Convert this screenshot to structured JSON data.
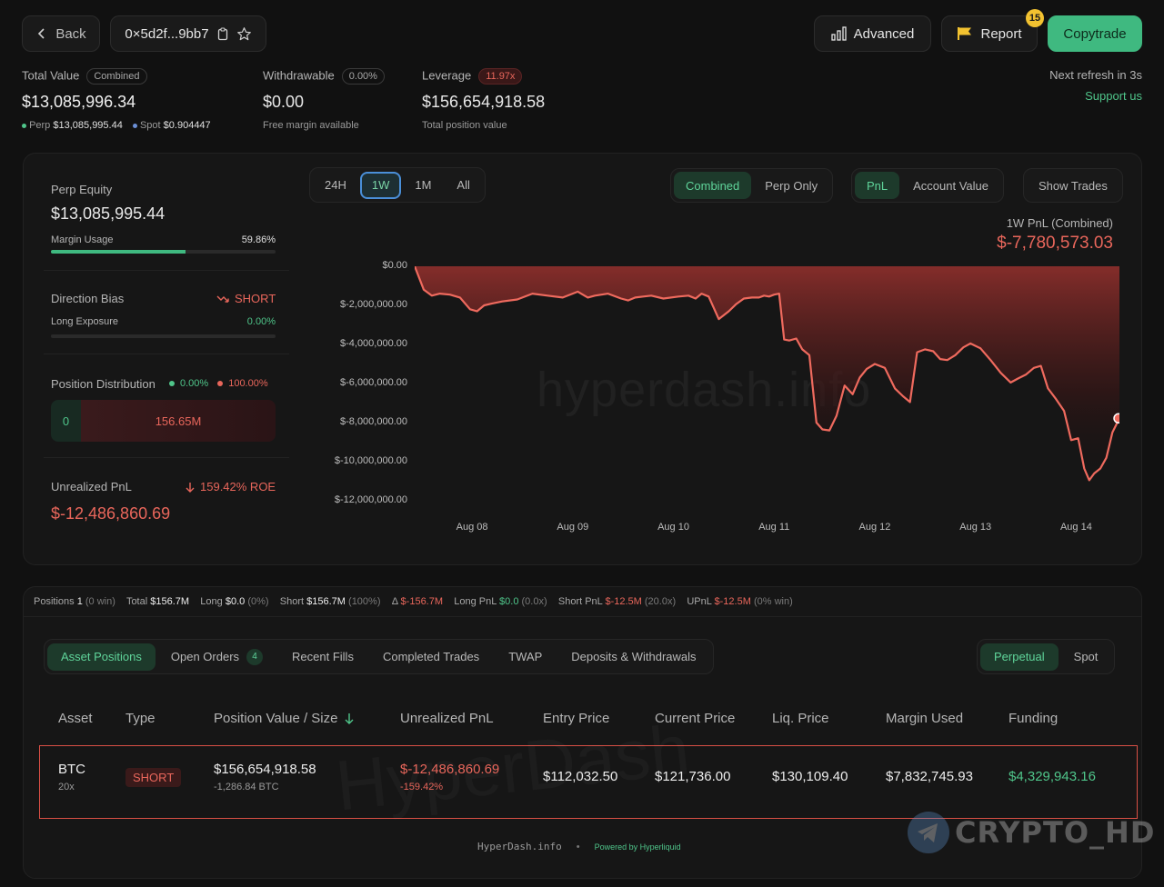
{
  "header": {
    "back_label": "Back",
    "address": "0×5d2f...9bb7",
    "advanced_label": "Advanced",
    "report_label": "Report",
    "report_badge": "15",
    "copytrade_label": "Copytrade"
  },
  "summary": {
    "total_value_label": "Total Value",
    "total_value_pill": "Combined",
    "total_value": "$13,085,996.34",
    "perp_label": "Perp",
    "perp_value": "$13,085,995.44",
    "spot_label": "Spot",
    "spot_value": "$0.904447",
    "withdrawable_label": "Withdrawable",
    "withdrawable_pill": "0.00%",
    "withdrawable_value": "$0.00",
    "withdrawable_sub": "Free margin available",
    "leverage_label": "Leverage",
    "leverage_pill": "11.97x",
    "leverage_value": "$156,654,918.58",
    "leverage_sub": "Total position value",
    "refresh_text": "Next refresh in 3s",
    "support_label": "Support us"
  },
  "left_panel": {
    "perp_equity_label": "Perp Equity",
    "perp_equity": "$13,085,995.44",
    "margin_usage_label": "Margin Usage",
    "margin_usage": "59.86%",
    "margin_usage_fraction": 0.5986,
    "direction_bias_label": "Direction Bias",
    "direction_bias": "SHORT",
    "long_exposure_label": "Long Exposure",
    "long_exposure": "0.00%",
    "position_distribution_label": "Position Distribution",
    "dist_long_pct": "0.00%",
    "dist_short_pct": "100.00%",
    "dist_long_value": "0",
    "dist_short_value": "156.65M",
    "unrealized_pnl_label": "Unrealized PnL",
    "roe": "159.42% ROE",
    "unrealized_pnl": "$-12,486,860.69"
  },
  "chart_controls": {
    "ranges": [
      "24H",
      "1W",
      "1M",
      "All"
    ],
    "active_range": "1W",
    "mode": [
      "Combined",
      "Perp Only"
    ],
    "metric": [
      "PnL",
      "Account Value"
    ],
    "show_trades": "Show Trades"
  },
  "chart_header": {
    "label": "1W PnL (Combined)",
    "value": "$-7,780,573.03"
  },
  "watermark": "hyperdash.info",
  "chart_data": {
    "type": "area",
    "title": "1W PnL (Combined)",
    "xlabel": "",
    "ylabel": "",
    "x_ticks": [
      "Aug 08",
      "Aug 09",
      "Aug 10",
      "Aug 11",
      "Aug 12",
      "Aug 13",
      "Aug 14"
    ],
    "y_ticks": [
      "$0.00",
      "$-2,000,000.00",
      "$-4,000,000.00",
      "$-6,000,000.00",
      "$-8,000,000.00",
      "$-10,000,000.00",
      "$-12,000,000.00"
    ],
    "ylim": [
      -12000000,
      0
    ],
    "xlim": [
      7.43,
      14.43
    ],
    "grid": false,
    "series": [
      {
        "x": [
          7.43,
          7.52,
          7.6,
          7.68,
          7.78,
          7.88,
          7.98,
          8.05,
          8.12,
          8.2,
          8.3,
          8.45,
          8.6,
          8.75,
          8.9,
          9.05,
          9.15,
          9.22,
          9.35,
          9.48,
          9.55,
          9.62,
          9.7,
          9.78,
          9.9,
          10.05,
          10.15,
          10.22,
          10.28,
          10.35,
          10.45,
          10.55,
          10.62,
          10.7,
          10.78,
          10.85,
          10.9,
          10.95,
          11.0,
          11.05,
          11.1,
          11.15,
          11.22,
          11.28,
          11.35,
          11.42,
          11.48,
          11.55,
          11.62,
          11.7,
          11.78,
          11.85,
          11.92,
          12.0,
          12.1,
          12.2,
          12.28,
          12.35,
          12.42,
          12.5,
          12.58,
          12.65,
          12.72,
          12.8,
          12.88,
          12.95,
          13.05,
          13.15,
          13.25,
          13.35,
          13.42,
          13.5,
          13.58,
          13.65,
          13.72,
          13.8,
          13.88,
          13.95,
          14.02,
          14.08,
          14.13,
          14.18,
          14.24,
          14.3,
          14.36,
          14.43
        ],
        "y": [
          0,
          -1200000,
          -1500000,
          -1400000,
          -1450000,
          -1600000,
          -2200000,
          -2300000,
          -2000000,
          -1900000,
          -1800000,
          -1700000,
          -1400000,
          -1500000,
          -1600000,
          -1300000,
          -1600000,
          -1500000,
          -1400000,
          -1650000,
          -1750000,
          -1600000,
          -1550000,
          -1500000,
          -1650000,
          -1550000,
          -1500000,
          -1650000,
          -1400000,
          -1550000,
          -2700000,
          -2300000,
          -1950000,
          -1650000,
          -1600000,
          -1600000,
          -1500000,
          -1550000,
          -1450000,
          -1400000,
          -3750000,
          -3800000,
          -3700000,
          -4250000,
          -4550000,
          -8000000,
          -8350000,
          -8400000,
          -7650000,
          -6100000,
          -6550000,
          -5700000,
          -5250000,
          -5000000,
          -5200000,
          -6250000,
          -6650000,
          -6950000,
          -4400000,
          -4250000,
          -4350000,
          -4750000,
          -4800000,
          -4550000,
          -4150000,
          -3950000,
          -4200000,
          -4800000,
          -5450000,
          -5950000,
          -5750000,
          -5550000,
          -5200000,
          -5100000,
          -6250000,
          -6800000,
          -7400000,
          -8900000,
          -8800000,
          -10350000,
          -10950000,
          -10600000,
          -10350000,
          -9800000,
          -8500000,
          -7780573
        ]
      }
    ]
  },
  "stats_bar": {
    "positions_label": "Positions",
    "positions_value": "1",
    "positions_win": "(0 win)",
    "total_label": "Total",
    "total_value": "$156.7M",
    "long_label": "Long",
    "long_value": "$0.0",
    "long_pct": "(0%)",
    "short_label": "Short",
    "short_value": "$156.7M",
    "short_pct": "(100%)",
    "delta_label": "Δ",
    "delta_value": "$-156.7M",
    "long_pnl_label": "Long PnL",
    "long_pnl_value": "$0.0",
    "long_pnl_x": "(0.0x)",
    "short_pnl_label": "Short PnL",
    "short_pnl_value": "$-12.5M",
    "short_pnl_x": "(20.0x)",
    "upnl_label": "UPnL",
    "upnl_value": "$-12.5M",
    "upnl_win": "(0% win)"
  },
  "tabs": {
    "items": [
      "Asset Positions",
      "Open Orders",
      "Recent Fills",
      "Completed Trades",
      "TWAP",
      "Deposits & Withdrawals"
    ],
    "open_orders_count": "4",
    "market": [
      "Perpetual",
      "Spot"
    ]
  },
  "table": {
    "headers": [
      "Asset",
      "Type",
      "Position Value / Size",
      "Unrealized PnL",
      "Entry Price",
      "Current Price",
      "Liq. Price",
      "Margin Used",
      "Funding"
    ],
    "row": {
      "asset": "BTC",
      "leverage": "20x",
      "type": "SHORT",
      "position_value": "$156,654,918.58",
      "size": "-1,286.84 BTC",
      "unrealized_pnl": "$-12,486,860.69",
      "unrealized_pct": "-159.42%",
      "entry_price": "$112,032.50",
      "current_price": "$121,736.00",
      "liq_price": "$130,109.40",
      "margin_used": "$7,832,745.93",
      "funding": "$4,329,943.16"
    }
  },
  "footer": {
    "site": "HyperDash.info",
    "dot": "•",
    "powered": "Powered by Hyperliquid"
  },
  "overlay_watermark": "CRYPTO_HD",
  "table_watermark": "HyperDash",
  "colors": {
    "accent_green": "#4fc58a",
    "accent_red": "#e8665b",
    "copytrade_bg": "#3fb980"
  }
}
